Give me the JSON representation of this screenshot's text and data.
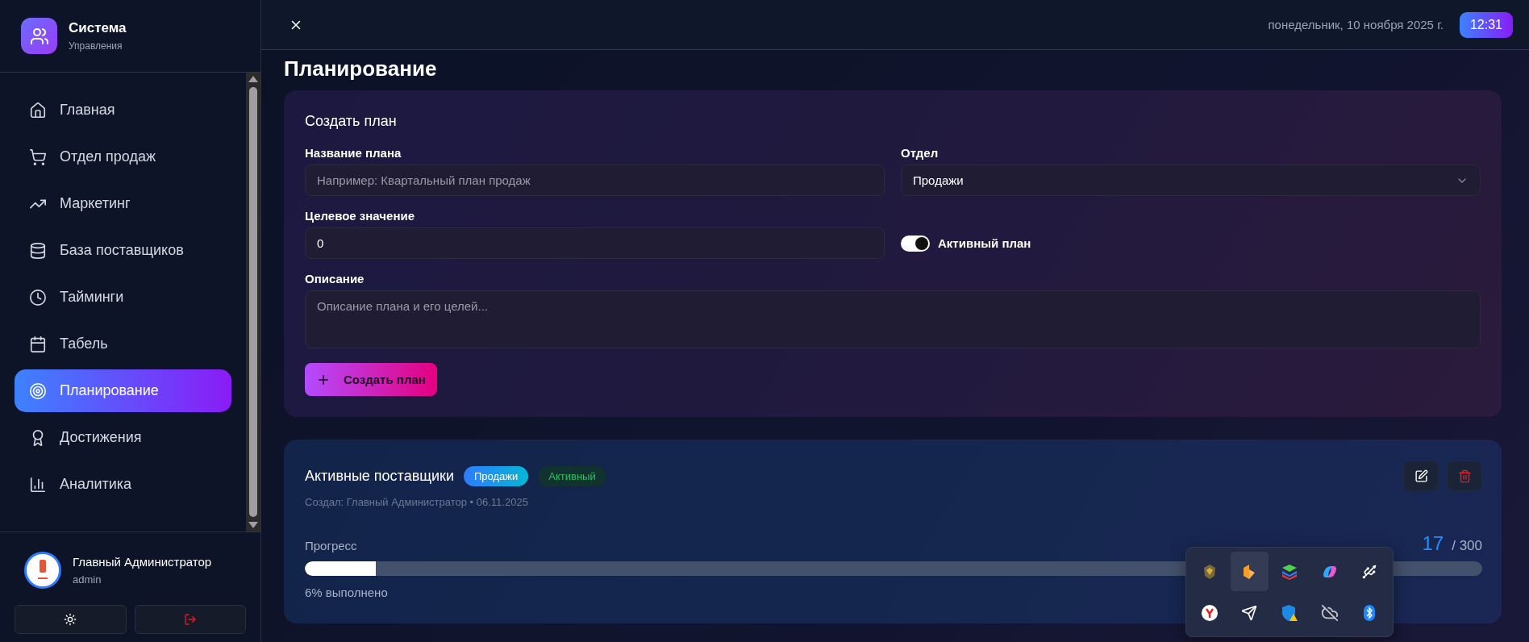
{
  "sidebar": {
    "brand": {
      "title": "Система",
      "subtitle": "Управления"
    },
    "items": [
      {
        "label": "Главная",
        "selected": false
      },
      {
        "label": "Отдел продаж",
        "selected": false
      },
      {
        "label": "Маркетинг",
        "selected": false
      },
      {
        "label": "База поставщиков",
        "selected": false
      },
      {
        "label": "Тайминги",
        "selected": false
      },
      {
        "label": "Табель",
        "selected": false
      },
      {
        "label": "Планирование",
        "selected": true
      },
      {
        "label": "Достижения",
        "selected": false
      },
      {
        "label": "Аналитика",
        "selected": false
      }
    ],
    "user": {
      "name": "Главный Администратор",
      "login": "admin"
    }
  },
  "header": {
    "date": "понедельник, 10 ноября 2025 г.",
    "time": "12:31"
  },
  "page_title": "Планирование",
  "form": {
    "title": "Создать план",
    "name_field": {
      "label": "Название плана",
      "placeholder": "Например: Квартальный план продаж"
    },
    "department_field": {
      "label": "Отдел",
      "value": "Продажи"
    },
    "target_field": {
      "label": "Целевое значение",
      "value": "0"
    },
    "active_toggle": {
      "label": "Активный план",
      "on": true
    },
    "description_field": {
      "label": "Описание",
      "placeholder": "Описание плана и его целей..."
    },
    "submit": "Создать план"
  },
  "plans": [
    {
      "title": "Активные поставщики",
      "department": "Продажи",
      "status": "Активный",
      "meta": "Создал: Главный Администратор • 06.11.2025",
      "progress_label": "Прогресс",
      "current": "17",
      "target": "/ 300",
      "level": 0.06,
      "done": "6% выполнено"
    }
  ],
  "tray": {
    "items": [
      {
        "kind": "helmet",
        "hovered": false
      },
      {
        "kind": "cube",
        "hovered": true
      },
      {
        "kind": "stack",
        "hovered": false
      },
      {
        "kind": "swirl",
        "hovered": false
      },
      {
        "kind": "usb",
        "hovered": false
      },
      {
        "kind": "browser",
        "hovered": false
      },
      {
        "kind": "send",
        "hovered": false
      },
      {
        "kind": "shield",
        "hovered": false
      },
      {
        "kind": "cloud",
        "hovered": false
      },
      {
        "kind": "bluetooth",
        "hovered": false
      }
    ]
  }
}
